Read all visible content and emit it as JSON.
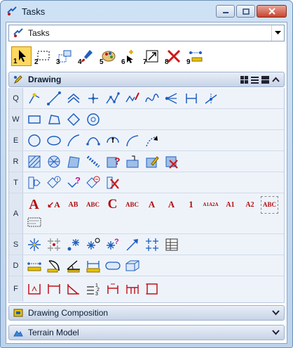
{
  "window": {
    "title": "Tasks",
    "title_icon": "tasks-icon",
    "controls": [
      "minimize-icon",
      "maximize-icon",
      "close-icon"
    ]
  },
  "task_selector": {
    "value": "Tasks",
    "icon": "tasks-icon"
  },
  "main_toolbar": {
    "items": [
      {
        "num": "1",
        "icon": "select-arrow-icon",
        "selected": true
      },
      {
        "num": "2",
        "icon": "dashed-selection-icon"
      },
      {
        "num": "3",
        "icon": "fence-icon"
      },
      {
        "num": "4",
        "icon": "brush-icon"
      },
      {
        "num": "5",
        "icon": "palette-icon"
      },
      {
        "num": "6",
        "icon": "smart-select-icon"
      },
      {
        "num": "7",
        "icon": "scale-icon"
      },
      {
        "num": "8",
        "icon": "delete-x-icon"
      },
      {
        "num": "9",
        "icon": "measure-icon"
      }
    ]
  },
  "drawing_section": {
    "title": "Drawing",
    "icon": "drawing-pencil-icon",
    "view_buttons": [
      "grid-view-icon",
      "list-view-icon",
      "detail-view-icon",
      "collapse-up-icon"
    ],
    "rows": [
      {
        "label": "Q",
        "icons": [
          "place-smartline-icon",
          "place-line-icon",
          "chevron-line-icon",
          "place-point-icon",
          "place-polyline-icon",
          "stream-curve-icon",
          "freeform-curve-icon",
          "construct-tangent-icon",
          "distance-icon",
          "point-on-line-icon"
        ]
      },
      {
        "label": "W",
        "icons": [
          "rectangle-icon",
          "shape-icon",
          "orthogonal-shape-icon",
          "circle-center-icon"
        ]
      },
      {
        "label": "E",
        "icons": [
          "circle-icon",
          "ellipse-icon",
          "arc-icon",
          "arc-end-icon",
          "half-ellipse-icon",
          "quarter-ellipse-icon",
          "modify-arc-icon"
        ]
      },
      {
        "label": "R",
        "icons": [
          "hatch-icon",
          "crosshatch-icon",
          "pattern-area-icon",
          "linear-pattern-icon",
          "show-pattern-icon",
          "match-pattern-icon",
          "edit-pattern-icon",
          "delete-pattern-icon"
        ]
      },
      {
        "label": "T",
        "icons": [
          "insert-cell-icon",
          "cell-library-icon",
          "identify-cell-icon",
          "replace-cell-icon",
          "delete-cell-icon"
        ]
      },
      {
        "label": "A",
        "texts": [
          "A",
          "↙A",
          "AB",
          "ABC",
          "C",
          "ABC",
          "A",
          "A",
          "1",
          "A1A2A",
          "A1",
          "A2",
          "ABC"
        ],
        "icons": [
          "place-text-icon",
          "text-leader-icon",
          "text-superscript-icon",
          "spell-check-icon",
          "text-replace-icon",
          "text-match-icon",
          "text-edit-icon",
          "text-move-icon",
          "text-number-icon",
          "text-align-icon",
          "text-increment-icon",
          "text-decrement-icon",
          "text-note-icon",
          "text-fill-icon"
        ]
      },
      {
        "label": "S",
        "icons": [
          "snowflake-icon",
          "pattern-grey-icon",
          "star-node-icon",
          "star-circle-icon",
          "star-question-icon",
          "star-arrow-icon",
          "star-spread-icon",
          "table-icon"
        ]
      },
      {
        "label": "D",
        "icons": [
          "dimension-linear-icon",
          "dimension-radial-icon",
          "dimension-angle-icon",
          "dimension-ordinate-icon",
          "dimension-pill-icon",
          "dimension-box-icon"
        ]
      },
      {
        "label": "F",
        "icons": [
          "frame-symbol-icon",
          "frame-width-icon",
          "frame-diagonal-icon",
          "frame-numbers-icon",
          "frame-rotate-icon",
          "frame-stretch-icon",
          "frame-square-icon"
        ]
      }
    ]
  },
  "collapsed_sections": [
    {
      "title": "Drawing Composition",
      "icon": "drawing-composition-icon"
    },
    {
      "title": "Terrain Model",
      "icon": "terrain-model-icon"
    }
  ],
  "colors": {
    "title_bar": "#bcd3ec",
    "selected_tool": "#ffd860",
    "icon_blue": "#1f5fbf",
    "icon_red": "#c0121b"
  }
}
